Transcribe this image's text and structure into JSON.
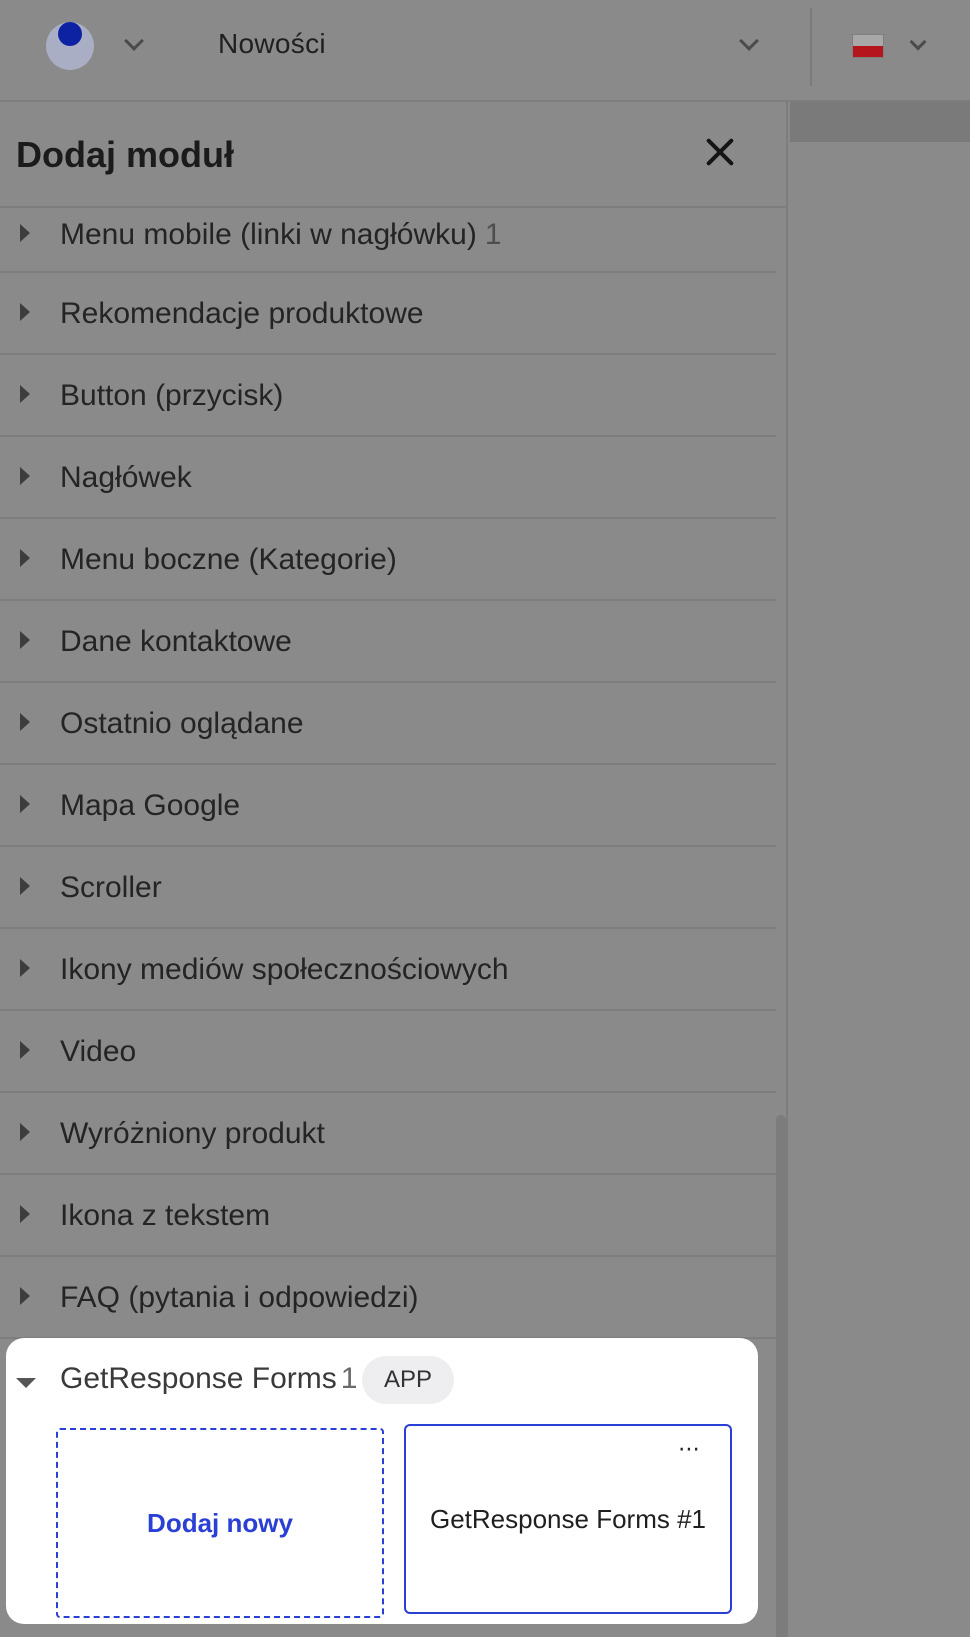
{
  "topbar": {
    "page_select": "Nowości",
    "language_flag": "pl-flag",
    "colors": {
      "logo_dot": "#0d22a3",
      "logo_ring": "#a9aec4"
    }
  },
  "panel": {
    "title": "Dodaj moduł",
    "modules": [
      {
        "label": "Menu mobile (linki w nagłówku)",
        "count": "1"
      },
      {
        "label": "Rekomendacje produktowe",
        "count": ""
      },
      {
        "label": "Button (przycisk)",
        "count": ""
      },
      {
        "label": "Nagłówek",
        "count": ""
      },
      {
        "label": "Menu boczne (Kategorie)",
        "count": ""
      },
      {
        "label": "Dane kontaktowe",
        "count": ""
      },
      {
        "label": "Ostatnio oglądane",
        "count": ""
      },
      {
        "label": "Mapa Google",
        "count": ""
      },
      {
        "label": "Scroller",
        "count": ""
      },
      {
        "label": "Ikony mediów społecznościowych",
        "count": ""
      },
      {
        "label": "Video",
        "count": ""
      },
      {
        "label": "Wyróżniony produkt",
        "count": ""
      },
      {
        "label": "Ikona z tekstem",
        "count": ""
      },
      {
        "label": "FAQ (pytania i odpowiedzi)",
        "count": ""
      }
    ],
    "expanded": {
      "label": "GetResponse Forms",
      "count": "1",
      "badge": "APP",
      "add_new_label": "Dodaj nowy",
      "items": [
        {
          "label": "GetResponse Forms #1",
          "menu_icon": "more-horizontal-icon"
        }
      ]
    },
    "accent_color": "#2a3fd4"
  }
}
